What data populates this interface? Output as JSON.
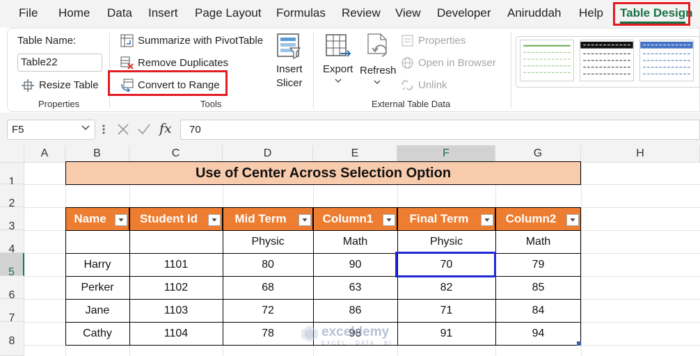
{
  "menu": {
    "items": [
      "File",
      "Home",
      "Data",
      "Insert",
      "Page Layout",
      "Formulas",
      "Review",
      "View",
      "Developer",
      "Aniruddah",
      "Help",
      "Table Design"
    ],
    "active_tab": "Table Design"
  },
  "ribbon": {
    "properties": {
      "table_name_label": "Table Name:",
      "table_name_value": "Table22",
      "resize_label": "Resize Table",
      "group_label": "Properties"
    },
    "tools": {
      "summarize_label": "Summarize with PivotTable",
      "remove_duplicates_label": "Remove Duplicates",
      "convert_label": "Convert to Range",
      "insert_slicer_line1": "Insert",
      "insert_slicer_line2": "Slicer",
      "group_label": "Tools"
    },
    "external": {
      "export_label": "Export",
      "refresh_label": "Refresh",
      "properties_label": "Properties",
      "open_browser_label": "Open in Browser",
      "unlink_label": "Unlink",
      "group_label": "External Table Data"
    }
  },
  "formula_bar": {
    "name_box": "F5",
    "value": "70"
  },
  "grid": {
    "columns": [
      "A",
      "B",
      "C",
      "D",
      "E",
      "F",
      "G",
      "H"
    ],
    "rows": [
      "1",
      "2",
      "3",
      "4",
      "5",
      "6",
      "7",
      "8"
    ],
    "selected_column": "F",
    "selected_row": "5"
  },
  "sheet": {
    "title": "Use of Center Across Selection Option",
    "headers": [
      "Name",
      "Student Id",
      "Mid Term",
      "Column1",
      "Final Term",
      "Column2"
    ],
    "subheaders": [
      "",
      "",
      "Physic",
      "Math",
      "Physic",
      "Math"
    ],
    "rows": [
      [
        "Harry",
        "1101",
        "80",
        "90",
        "70",
        "79"
      ],
      [
        "Perker",
        "1102",
        "68",
        "63",
        "82",
        "85"
      ],
      [
        "Jane",
        "1103",
        "72",
        "86",
        "71",
        "84"
      ],
      [
        "Cathy",
        "1104",
        "78",
        "98",
        "91",
        "94"
      ]
    ]
  },
  "watermark": {
    "name": "exceldemy",
    "tagline": "EXCEL · DATA · BI"
  },
  "colors": {
    "excel_green": "#177245",
    "table_header": "#ed7d31",
    "title_fill": "#f8cbad",
    "highlight_red": "#e21c23",
    "active_cell": "#1f28d6"
  }
}
